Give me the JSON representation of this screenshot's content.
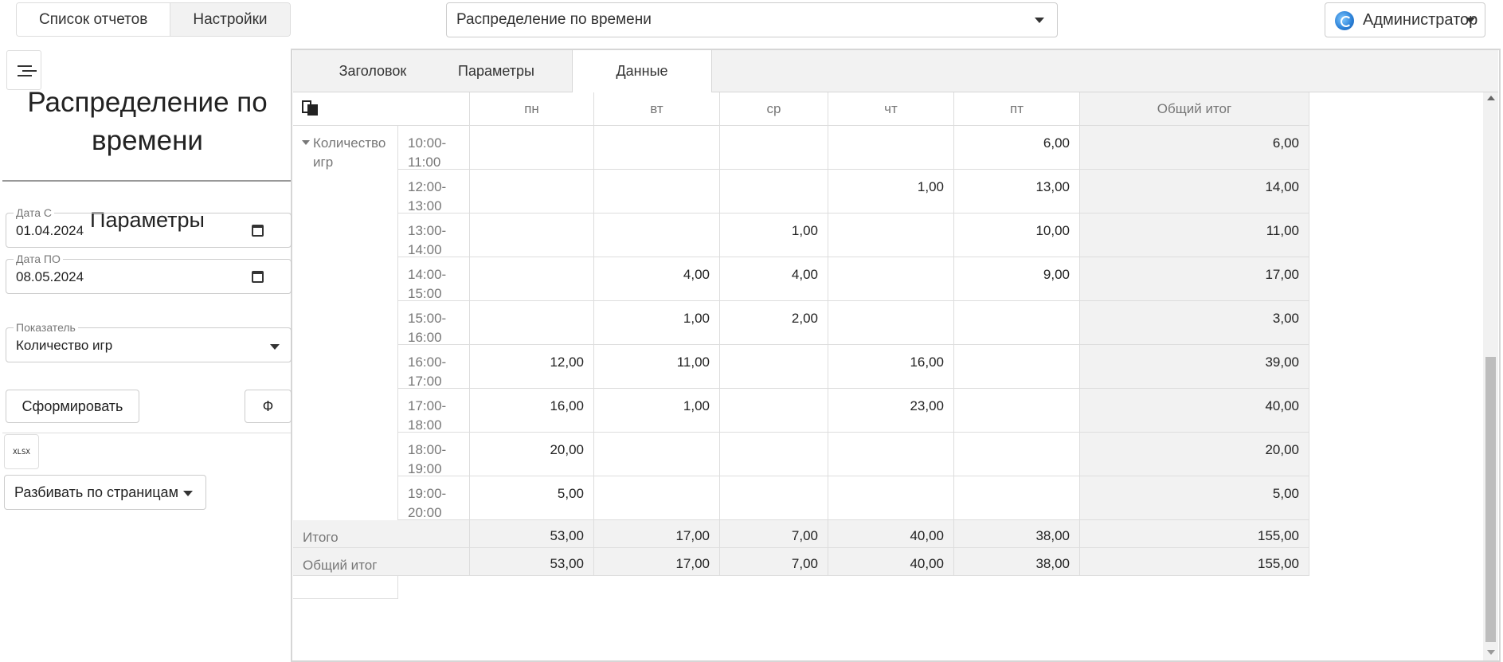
{
  "top": {
    "tabs": [
      {
        "label": "Список отчетов",
        "active": false
      },
      {
        "label": "Настройки",
        "active": true
      }
    ],
    "report_selected": "Распределение по времени",
    "user": "Администратор"
  },
  "left": {
    "title": "Распределение по времени",
    "params_title": "Параметры",
    "date_from": {
      "label": "Дата С",
      "value": "01.04.2024"
    },
    "date_to": {
      "label": "Дата ПО",
      "value": "08.05.2024"
    },
    "metric": {
      "label": "Показатель",
      "value": "Количество игр"
    },
    "generate_label": "Сформировать",
    "f_label": "Ф",
    "xlsx_label": "XLSX",
    "paging_label": "Разбивать по страницам"
  },
  "tabs": [
    {
      "label": "Заголовок",
      "active": false
    },
    {
      "label": "Параметры",
      "active": false
    },
    {
      "label": "Данные",
      "active": true
    }
  ],
  "table": {
    "columns": [
      "пн",
      "вт",
      "ср",
      "чт",
      "пт",
      "Общий итог"
    ],
    "group_label": "Количество игр",
    "rows": [
      {
        "time": "10:00-11:00",
        "values": [
          "",
          "",
          "",
          "",
          "6,00",
          "6,00"
        ]
      },
      {
        "time": "12:00-13:00",
        "values": [
          "",
          "",
          "",
          "1,00",
          "13,00",
          "14,00"
        ]
      },
      {
        "time": "13:00-14:00",
        "values": [
          "",
          "",
          "1,00",
          "",
          "10,00",
          "11,00"
        ]
      },
      {
        "time": "14:00-15:00",
        "values": [
          "",
          "4,00",
          "4,00",
          "",
          "9,00",
          "17,00"
        ]
      },
      {
        "time": "15:00-16:00",
        "values": [
          "",
          "1,00",
          "2,00",
          "",
          "",
          "3,00"
        ]
      },
      {
        "time": "16:00-17:00",
        "values": [
          "12,00",
          "11,00",
          "",
          "16,00",
          "",
          "39,00"
        ]
      },
      {
        "time": "17:00-18:00",
        "values": [
          "16,00",
          "1,00",
          "",
          "23,00",
          "",
          "40,00"
        ]
      },
      {
        "time": "18:00-19:00",
        "values": [
          "20,00",
          "",
          "",
          "",
          "",
          "20,00"
        ]
      },
      {
        "time": "19:00-20:00",
        "values": [
          "5,00",
          "",
          "",
          "",
          "",
          "5,00"
        ]
      }
    ],
    "footers": [
      {
        "label": "Итого",
        "values": [
          "53,00",
          "17,00",
          "7,00",
          "40,00",
          "38,00",
          "155,00"
        ]
      },
      {
        "label": "Общий итог",
        "values": [
          "53,00",
          "17,00",
          "7,00",
          "40,00",
          "38,00",
          "155,00"
        ]
      }
    ]
  },
  "colors": {
    "border": "#dddddd",
    "total_bg": "#f2f2f2",
    "header_text": "#777777"
  }
}
